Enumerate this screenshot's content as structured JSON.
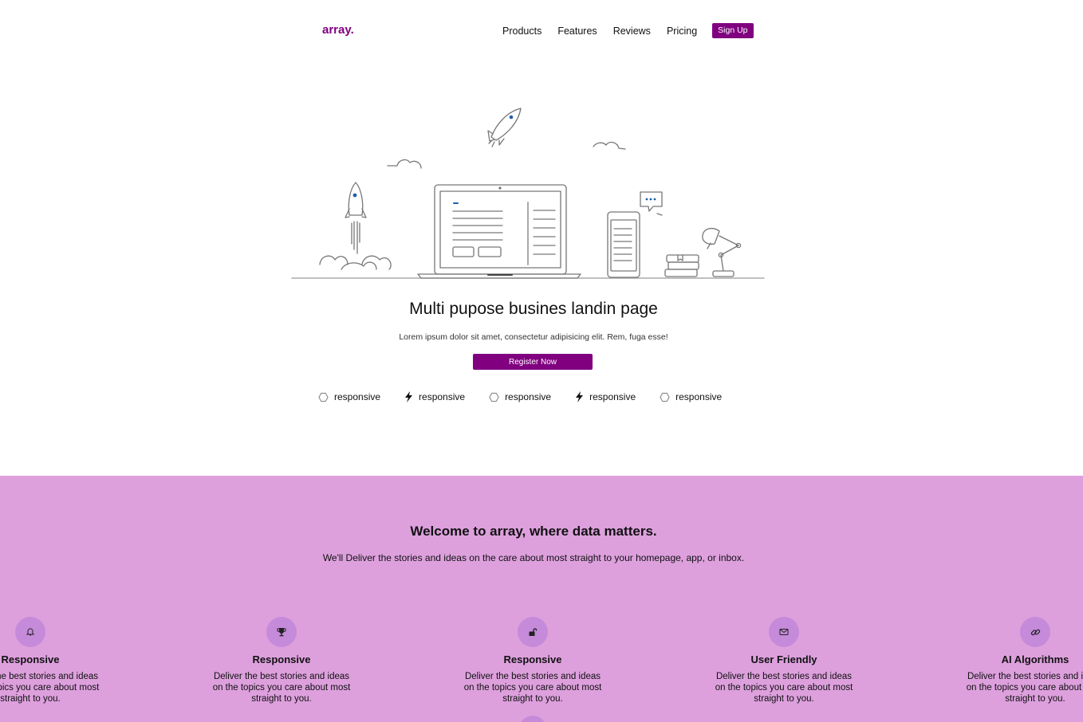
{
  "brand": {
    "logo": "array.",
    "accent_color": "#800080"
  },
  "nav": {
    "links": [
      "Products",
      "Features",
      "Reviews",
      "Pricing"
    ],
    "signup_label": "Sign Up"
  },
  "hero": {
    "title": "Multi pupose busines landin page",
    "subtitle": "Lorem ipsum dolor sit amet, consectetur adipisicing elit. Rem, fuga esse!",
    "cta_label": "Register Now",
    "badges": [
      {
        "icon": "hexagon-icon",
        "label": "responsive"
      },
      {
        "icon": "bolt-icon",
        "label": "responsive"
      },
      {
        "icon": "hexagon-icon",
        "label": "responsive"
      },
      {
        "icon": "bolt-icon",
        "label": "responsive"
      },
      {
        "icon": "hexagon-icon",
        "label": "responsive"
      }
    ]
  },
  "welcome": {
    "background_color": "#dda0dd",
    "title": "Welcome to array, where data matters.",
    "subtitle": "We'll Deliver the stories and ideas on the care about most straight to your homepage, app, or inbox.",
    "features": [
      {
        "icon": "bell-icon",
        "title": "Responsive",
        "description": "Deliver the best stories and ideas on the topics you care about most straight to you."
      },
      {
        "icon": "trophy-icon",
        "title": "Responsive",
        "description": "Deliver the best stories and ideas on the topics you care about most straight to you."
      },
      {
        "icon": "unlock-icon",
        "title": "Responsive",
        "description": "Deliver the best stories and ideas on the topics you care about most straight to you."
      },
      {
        "icon": "envelope-icon",
        "title": "User Friendly",
        "description": "Deliver the best stories and ideas on the topics you care about most straight to you."
      },
      {
        "icon": "link-icon",
        "title": "AI Algorithms",
        "description": "Deliver the best stories and ideas on the topics you care about most straight to you."
      }
    ]
  }
}
